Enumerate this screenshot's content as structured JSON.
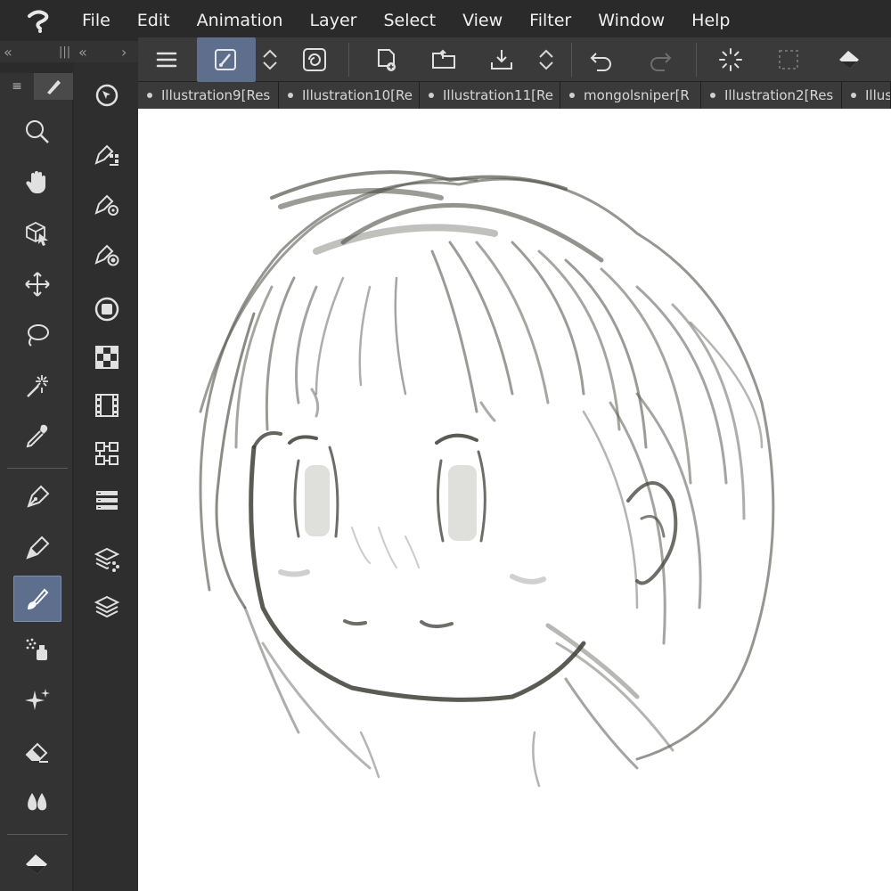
{
  "menubar": {
    "items": [
      "File",
      "Edit",
      "Animation",
      "Layer",
      "Select",
      "View",
      "Filter",
      "Window",
      "Help"
    ]
  },
  "left_collapse": {
    "left": "«",
    "middle": "|||",
    "right_double": "«",
    "right": "›"
  },
  "toolbar": {
    "buttons": [
      "menu-icon",
      "pen-edit-icon",
      "up-down-arrows-icon",
      "swirl-icon",
      "new-canvas-icon",
      "open-folder-icon",
      "save-download-icon",
      "up-down-arrows-icon",
      "undo-icon",
      "redo-icon",
      "loading-icon",
      "selection-icon",
      "fill-icon"
    ]
  },
  "tabs": [
    {
      "label": "Illustration9[Res"
    },
    {
      "label": "Illustration10[Re"
    },
    {
      "label": "Illustration11[Re"
    },
    {
      "label": "mongolsniper[R"
    },
    {
      "label": "Illustration2[Res"
    },
    {
      "label": "Illus"
    }
  ],
  "palette": {
    "menu_symbol": "≡",
    "tools": [
      "zoom-icon",
      "hand-icon",
      "3d-object-icon",
      "move-icon",
      "lasso-icon",
      "magic-wand-icon",
      "eyedropper-icon",
      "pen-icon",
      "pencil-icon",
      "brush-icon",
      "airbrush-icon",
      "decoration-icon",
      "eraser-icon",
      "blend-icon",
      "fill-icon"
    ],
    "active_tool": "brush-icon"
  },
  "colors": {
    "accent": "#5e6f8e",
    "panel": "#333333",
    "canvas": "#ffffff",
    "stroke": "#4a4a40"
  }
}
